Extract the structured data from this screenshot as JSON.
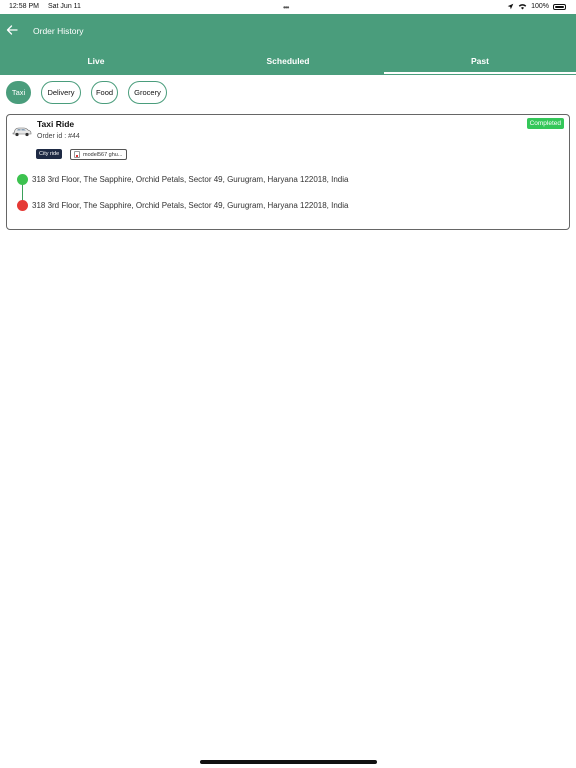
{
  "status_bar": {
    "time": "12:58 PM",
    "date": "Sat Jun 11",
    "battery": "100%"
  },
  "header": {
    "title": "Order History"
  },
  "tabs": [
    {
      "label": "Live",
      "active": false
    },
    {
      "label": "Scheduled",
      "active": false
    },
    {
      "label": "Past",
      "active": true
    }
  ],
  "categories": [
    {
      "label": "Taxi",
      "active": true
    },
    {
      "label": "Delivery",
      "active": false
    },
    {
      "label": "Food",
      "active": false
    },
    {
      "label": "Grocery",
      "active": false
    }
  ],
  "orders": [
    {
      "title": "Taxi Ride",
      "order_id": "Order id : #44",
      "status": "Completed",
      "ride_type": "City ride",
      "vehicle": "model567 ghu...",
      "pickup": "318 3rd Floor, The Sapphire, Orchid Petals, Sector 49, Gurugram, Haryana 122018, India",
      "drop": "318 3rd Floor, The Sapphire, Orchid Petals, Sector 49, Gurugram, Haryana 122018, India"
    }
  ],
  "colors": {
    "accent": "#4a9d7c",
    "completed": "#34c759",
    "pickup": "#3cc24f",
    "drop": "#e53935",
    "ride_type_bg": "#1e2a44"
  }
}
